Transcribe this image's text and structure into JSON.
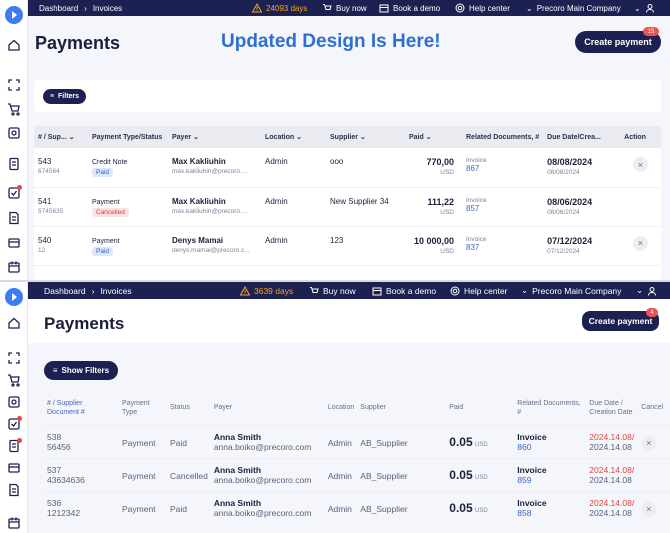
{
  "topbar": {
    "breadcrumb": [
      "Dashboard",
      "Invoices"
    ],
    "trial_top": "24093 days",
    "trial_bottom": "3639 days",
    "buy_now": "Buy now",
    "book_demo": "Book a demo",
    "help_center": "Help center",
    "company": "Precoro Main Company"
  },
  "page": {
    "title": "Payments",
    "create_button": "Create payment",
    "badge_top": "15",
    "badge_bottom": "4",
    "banner": "Updated Design Is Here!"
  },
  "old_design": {
    "filters_label": "Filters",
    "columns": [
      "# / Sup...",
      "Payment Type/Status",
      "Payer",
      "Location",
      "Supplier",
      "Paid",
      "Related Documents, #",
      "Due Date/Crea...",
      "Action"
    ],
    "rows": [
      {
        "num": "543",
        "sub": "674564",
        "type": "Credit Note",
        "status": "Paid",
        "status_kind": "paid",
        "payer": "Max Kakliuhin",
        "payer_email": "max.kakliuhin@precoro....",
        "location": "Admin",
        "supplier": "ooo",
        "amount": "770,00",
        "currency": "USD",
        "doc_type": "Invoice",
        "doc_num": "867",
        "due": "08/08/2024",
        "created": "08/08/2024",
        "action": "×"
      },
      {
        "num": "541",
        "sub": "5745635",
        "type": "Payment",
        "status": "Cancelled",
        "status_kind": "cancel",
        "payer": "Max Kakliuhin",
        "payer_email": "max.kakliuhin@precoro....",
        "location": "Admin",
        "supplier": "New Supplier 34",
        "amount": "111,22",
        "currency": "USD",
        "doc_type": "Invoice",
        "doc_num": "857",
        "due": "08/06/2024",
        "created": "08/06/2024",
        "action": ""
      },
      {
        "num": "540",
        "sub": "12",
        "type": "Payment",
        "status": "Paid",
        "status_kind": "paid",
        "payer": "Denys Mamai",
        "payer_email": "denys.mamai@precoro.c...",
        "location": "Admin",
        "supplier": "123",
        "amount": "10 000,00",
        "currency": "USD",
        "doc_type": "Invoice",
        "doc_num": "837",
        "due": "07/12/2024",
        "created": "07/12/2024",
        "action": "×"
      }
    ]
  },
  "new_design": {
    "filters_label": "Show Filters",
    "columns": [
      "# / Supplier Document #",
      "Payment Type",
      "Status",
      "Payer",
      "Location",
      "Supplier",
      "Paid",
      "Related Documents, #",
      "Due Date / Creation Date",
      "Cancel"
    ],
    "rows": [
      {
        "num": "538",
        "sub": "56456",
        "type": "Payment",
        "status": "Paid",
        "payer": "Anna Smith",
        "payer_email": "anna.boiko@precoro.com",
        "location": "Admin",
        "supplier": "AB_Supplier",
        "amount": "0.05",
        "currency": "USD",
        "doc_type": "Invoice",
        "doc_num": "860",
        "due": "2024.14.08/",
        "created": "2024.14.08",
        "action": "×"
      },
      {
        "num": "537",
        "sub": "43634636",
        "type": "Payment",
        "status": "Cancelled",
        "payer": "Anna Smith",
        "payer_email": "anna.boiko@precoro.com",
        "location": "Admin",
        "supplier": "AB_Supplier",
        "amount": "0.05",
        "currency": "USD",
        "doc_type": "Invoice",
        "doc_num": "859",
        "due": "2024.14.08/",
        "created": "2024.14.08",
        "action": ""
      },
      {
        "num": "536",
        "sub": "1212342",
        "type": "Payment",
        "status": "Paid",
        "payer": "Anna Smith",
        "payer_email": "anna.boiko@precoro.com",
        "location": "Admin",
        "supplier": "AB_Supplier",
        "amount": "0.05",
        "currency": "USD",
        "doc_type": "Invoice",
        "doc_num": "858",
        "due": "2024.14.08/",
        "created": "2024.14.08",
        "action": "×"
      }
    ]
  },
  "colors": {
    "navy": "#1d2152",
    "accent": "#3d7bf2",
    "banner": "#2f6fd1",
    "warning": "#f5a524",
    "danger": "#e2463f"
  }
}
